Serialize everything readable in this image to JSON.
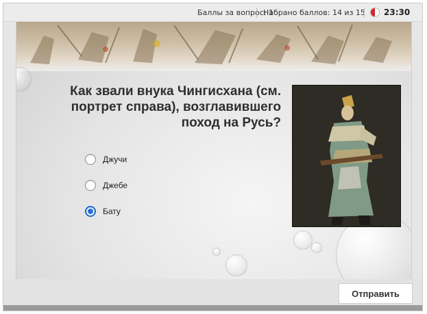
{
  "topbar": {
    "points_per_question": "Баллы за вопрос: 1",
    "score": "Набрано баллов: 14 из 15",
    "timer": "23:30",
    "timer_color": "#d9222a"
  },
  "question": {
    "text": "Как звали внука Чингисхана (см. портрет справа), возглавившего поход на Русь?",
    "options": [
      {
        "label": "Джучи",
        "selected": false
      },
      {
        "label": "Джебе",
        "selected": false
      },
      {
        "label": "Бату",
        "selected": true
      }
    ]
  },
  "actions": {
    "submit_label": "Отправить"
  },
  "accent_color": "#2a6fd6"
}
